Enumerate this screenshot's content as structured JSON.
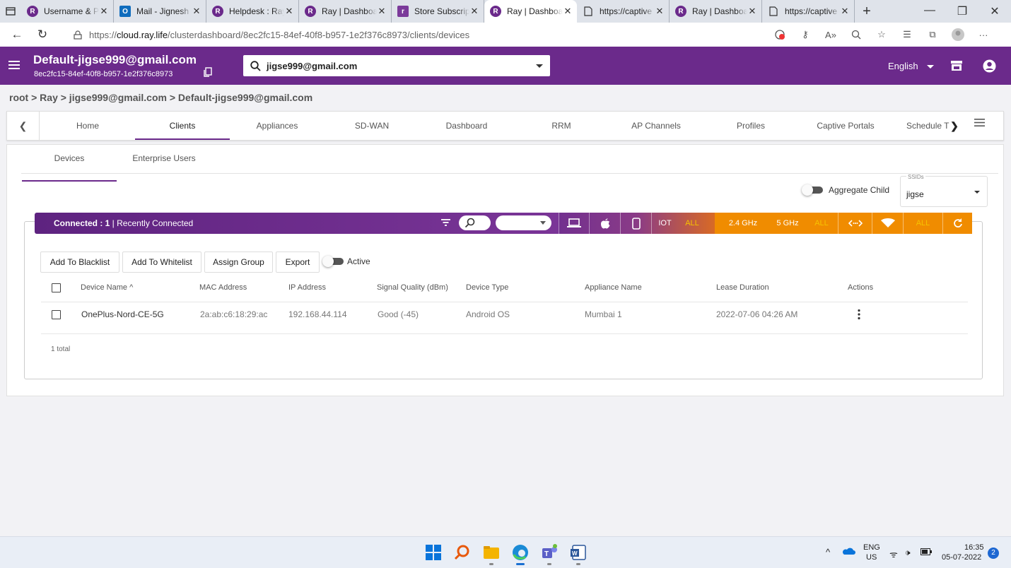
{
  "browser": {
    "tabs": [
      {
        "title": "Username & P",
        "favicon": "ray-logo"
      },
      {
        "title": "Mail - Jignesh",
        "favicon": "outlook-icon"
      },
      {
        "title": "Helpdesk : Ray",
        "favicon": "ray-logo"
      },
      {
        "title": "Ray | Dashboa",
        "favicon": "ray-logo"
      },
      {
        "title": "Store Subscrip",
        "favicon": "store-icon"
      },
      {
        "title": "Ray | Dashboa",
        "favicon": "ray-logo",
        "active": true
      },
      {
        "title": "https://captive",
        "favicon": "page-icon"
      },
      {
        "title": "Ray | Dashboa",
        "favicon": "ray-logo"
      },
      {
        "title": "https://captive",
        "favicon": "page-icon"
      }
    ],
    "url_prefix": "https://",
    "url_host": "cloud.ray.life",
    "url_path": "/clusterdashboard/8ec2fc15-84ef-40f8-b957-1e2f376c8973/clients/devices"
  },
  "header": {
    "account_name": "Default-jigse999@gmail.com",
    "account_id": "8ec2fc15-84ef-40f8-b957-1e2f376c8973",
    "search_value": "jigse999@gmail.com",
    "language": "English",
    "brand_color": "#6b2a8b"
  },
  "breadcrumb": "root > Ray > jigse999@gmail.com > Default-jigse999@gmail.com",
  "nav": {
    "items": [
      "Home",
      "Clients",
      "Appliances",
      "SD-WAN",
      "Dashboard",
      "RRM",
      "AP Channels",
      "Profiles",
      "Captive Portals",
      "Schedule T"
    ],
    "active": "Clients"
  },
  "subtabs": {
    "devices": "Devices",
    "enterprise": "Enterprise Users"
  },
  "aggregate_child": {
    "label": "Aggregate Child",
    "enabled": false
  },
  "ssids": {
    "legend": "SSIDs",
    "value": "jigse"
  },
  "filter_bar": {
    "connected_label": "Connected : 1",
    "recent_label": " | Recently Connected",
    "iot_label": "IOT",
    "all_label": "ALL",
    "freq_24": "2.4 GHz",
    "freq_5": "5 GHz",
    "freq_all": "ALL",
    "conn_all": "ALL"
  },
  "buttons": {
    "blacklist": "Add To Blacklist",
    "whitelist": "Add To Whitelist",
    "assign": "Assign Group",
    "export": "Export",
    "active_label": "Active"
  },
  "table": {
    "headers": [
      "Device Name ^",
      "MAC Address",
      "IP Address",
      "Signal Quality (dBm)",
      "Device Type",
      "Appliance Name",
      "Lease Duration",
      "Actions"
    ],
    "rows": [
      {
        "device_name": "OnePlus-Nord-CE-5G",
        "mac": "2a:ab:c6:18:29:ac",
        "ip": "192.168.44.114",
        "signal": "Good (-45)",
        "type": "Android OS",
        "appliance": "Mumbai 1",
        "lease": "2022-07-06 04:26 AM"
      }
    ],
    "total": "1 total"
  },
  "taskbar": {
    "lang": "ENG",
    "region": "US",
    "time": "16:35",
    "date": "05-07-2022",
    "notifications": "2"
  }
}
